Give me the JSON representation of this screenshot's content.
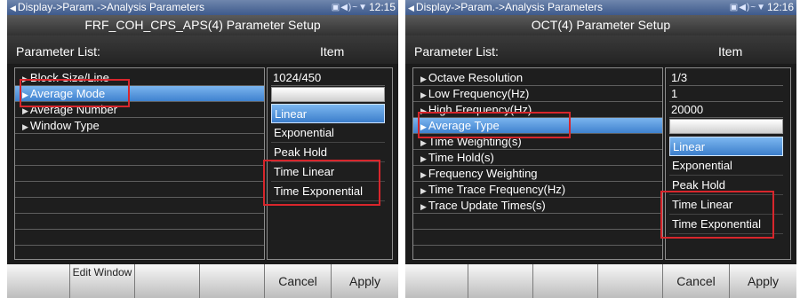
{
  "left": {
    "breadcrumb": "Display->Param.->Analysis Parameters",
    "status_icons": "▣◀)~▼",
    "time": "12:15",
    "title": "FRF_COH_CPS_APS(4) Parameter Setup",
    "param_list_label": "Parameter List:",
    "item_label": "Item",
    "params": [
      "Block Size/Line",
      "Average Mode",
      "Average Number",
      "Window Type"
    ],
    "selected_index": 1,
    "values": [
      "1024/450"
    ],
    "options": [
      "Linear",
      "Exponential",
      "Peak Hold",
      "Time Linear",
      "Time Exponential"
    ],
    "highlighted_option": 0,
    "buttons": [
      "",
      "Edit Window",
      "",
      "",
      "Cancel",
      "Apply"
    ]
  },
  "right": {
    "breadcrumb": "Display->Param.->Analysis Parameters",
    "status_icons": "▣◀)~▼",
    "time": "12:16",
    "title": "OCT(4) Parameter Setup",
    "param_list_label": "Parameter List:",
    "item_label": "Item",
    "params": [
      "Octave Resolution",
      "Low Frequency(Hz)",
      "High Frequency(Hz)",
      "Average Type",
      "Time Weighting(s)",
      "Time Hold(s)",
      "Frequency Weighting",
      "Time Trace Frequency(Hz)",
      "Trace Update Times(s)"
    ],
    "selected_index": 3,
    "values": [
      "1/3",
      "1",
      "20000"
    ],
    "options": [
      "Linear",
      "Exponential",
      "Peak Hold",
      "Time Linear",
      "Time Exponential"
    ],
    "highlighted_option": 0,
    "buttons": [
      "",
      "",
      "",
      "",
      "Cancel",
      "Apply"
    ]
  }
}
